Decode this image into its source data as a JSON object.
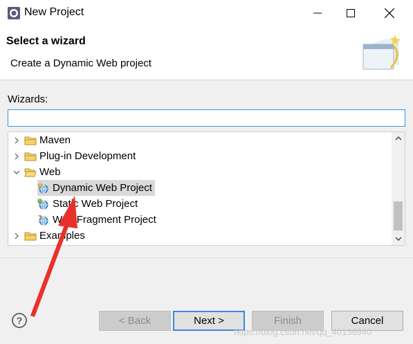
{
  "window": {
    "title": "New Project",
    "icon": "eclipse-icon"
  },
  "banner": {
    "title": "Select a wizard",
    "description": "Create a Dynamic Web project",
    "graphic": "wizard-banner-icon"
  },
  "wizards": {
    "label": "Wizards:",
    "filter_value": "",
    "tree": [
      {
        "label": "Maven",
        "type": "folder",
        "expanded": false
      },
      {
        "label": "Plug-in Development",
        "type": "folder",
        "expanded": false
      },
      {
        "label": "Web",
        "type": "folder",
        "expanded": true
      },
      {
        "label": "Dynamic Web Project",
        "type": "web-project",
        "selected": true
      },
      {
        "label": "Static Web Project",
        "type": "web-project"
      },
      {
        "label": "Web Fragment Project",
        "type": "web-project"
      },
      {
        "label": "Examples",
        "type": "folder",
        "expanded": false
      }
    ]
  },
  "buttons": {
    "help": "?",
    "back": "< Back",
    "next": "Next >",
    "finish": "Finish",
    "cancel": "Cancel"
  },
  "watermark": "https://blog.csdn.net/qq_40136940",
  "colors": {
    "accent": "#3c8ad8",
    "annotation_arrow": "#e8312a",
    "selection": "#d9d9d9"
  }
}
